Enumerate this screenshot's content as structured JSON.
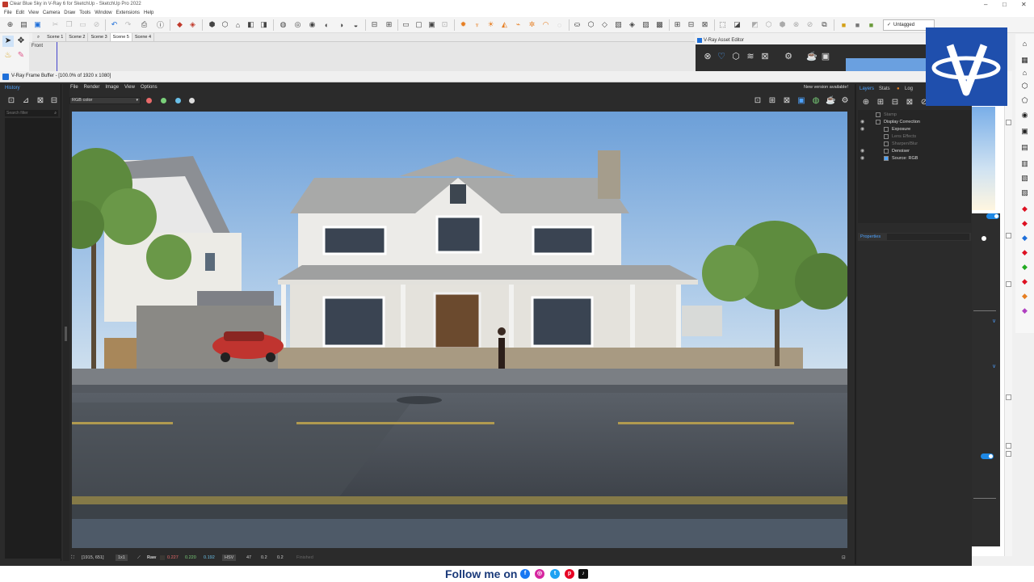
{
  "sketchup": {
    "title": "Clear Blue Sky in V-Ray 6 for SketchUp - SketchUp Pro 2022",
    "menu": [
      "File",
      "Edit",
      "View",
      "Camera",
      "Draw",
      "Tools",
      "Window",
      "Extensions",
      "Help"
    ],
    "tag_dropdown": "Untagged",
    "scenes": [
      "Scene 1",
      "Scene 2",
      "Scene 3",
      "Scene 5",
      "Scene 4"
    ],
    "active_scene": "Scene 5",
    "view_label": "Front"
  },
  "asset_editor": {
    "title": "V-Ray Asset Editor"
  },
  "vfb": {
    "title": "V-Ray Frame Buffer - [100.0% of 1920 x 1080]",
    "menu": [
      "File",
      "Render",
      "Image",
      "View",
      "Options"
    ],
    "update_notice": "New version available!",
    "history_label": "History",
    "search_placeholder": "Search filter",
    "channel": "RGB color",
    "status": {
      "coords": "[1915, 651]",
      "zoom": "1x1",
      "mode": "Raw",
      "r": "0.227",
      "g": "0.220",
      "b": "0.192",
      "color_space": "HSV",
      "h": "47",
      "s": "0.2",
      "v": "0.2",
      "state": "Finished"
    }
  },
  "layers_panel": {
    "tabs": [
      "Layers",
      "Stats",
      "Log"
    ],
    "properties_label": "Properties",
    "rows": [
      {
        "label": "Stamp",
        "visible": false,
        "enabled": false
      },
      {
        "label": "Display Correction",
        "visible": true,
        "enabled": true
      },
      {
        "label": "Exposure",
        "visible": true,
        "enabled": true
      },
      {
        "label": "Lens Effects",
        "visible": false,
        "enabled": false
      },
      {
        "label": "Sharpen/Blur",
        "visible": false,
        "enabled": false
      },
      {
        "label": "Denoiser",
        "visible": true,
        "enabled": true
      },
      {
        "label": "Source: RGB",
        "visible": true,
        "enabled": true
      }
    ]
  },
  "follow": {
    "text": "Follow me on"
  },
  "colors": {
    "vray_blue": "#1f4fad",
    "panel_dark": "#2b2b2b",
    "accent": "#4ea3ff"
  }
}
